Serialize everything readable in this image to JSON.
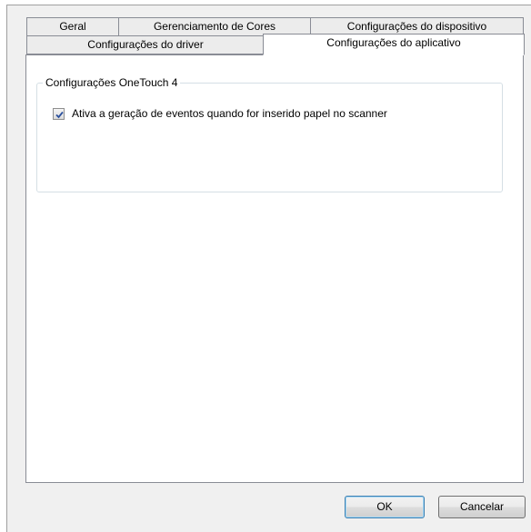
{
  "tabs_row1": [
    "Geral",
    "Gerenciamento de Cores",
    "Configurações do dispositivo"
  ],
  "tabs_row2": [
    "Configurações do driver",
    "Configurações do aplicativo"
  ],
  "group": {
    "label": "Configurações OneTouch 4",
    "checkbox_label": "Ativa a geração de eventos quando for inserido papel no scanner",
    "checkbox_checked": true
  },
  "buttons": {
    "ok": "OK",
    "cancel": "Cancelar"
  }
}
